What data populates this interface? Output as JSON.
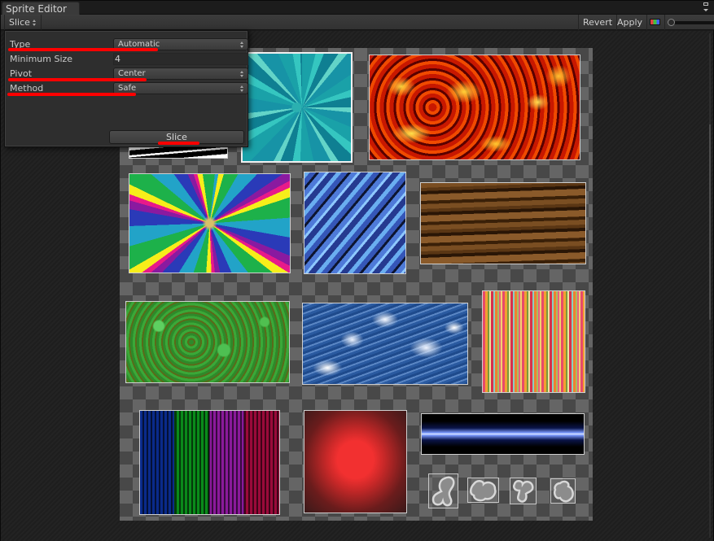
{
  "window": {
    "title": "Sprite Editor"
  },
  "toolbar": {
    "slice_menu_label": "Slice",
    "revert_label": "Revert",
    "apply_label": "Apply",
    "color_toggle_icon": "rgb-channels-icon",
    "zoom_slider_value": 0
  },
  "slice_popup": {
    "type": {
      "label": "Type",
      "value": "Automatic"
    },
    "minimum_size": {
      "label": "Minimum Size",
      "value": "4"
    },
    "pivot": {
      "label": "Pivot",
      "value": "Center"
    },
    "method": {
      "label": "Method",
      "value": "Safe"
    },
    "slice_button_label": "Slice"
  },
  "annotations": {
    "color": "#ff0000",
    "highlighted": [
      "Type",
      "Pivot",
      "Method",
      "Slice"
    ]
  },
  "sprite_sheet": {
    "sprites": [
      {
        "name": "zebra-stripes"
      },
      {
        "name": "teal-swirl"
      },
      {
        "name": "lava"
      },
      {
        "name": "rainbow-spiral"
      },
      {
        "name": "blue-camo"
      },
      {
        "name": "wood-grain"
      },
      {
        "name": "green-terrain"
      },
      {
        "name": "blue-clouds"
      },
      {
        "name": "candy-stripes"
      },
      {
        "name": "neon-streaks"
      },
      {
        "name": "red-glow"
      },
      {
        "name": "blue-energy-beam"
      },
      {
        "name": "petal-1"
      },
      {
        "name": "petal-2"
      },
      {
        "name": "petal-3"
      },
      {
        "name": "petal-4"
      }
    ]
  },
  "colors": {
    "background": "#1b1b1b",
    "panel": "#2e2e2e",
    "checker_light": "#656565",
    "checker_dark": "#484848",
    "highlight": "#ff0000"
  }
}
